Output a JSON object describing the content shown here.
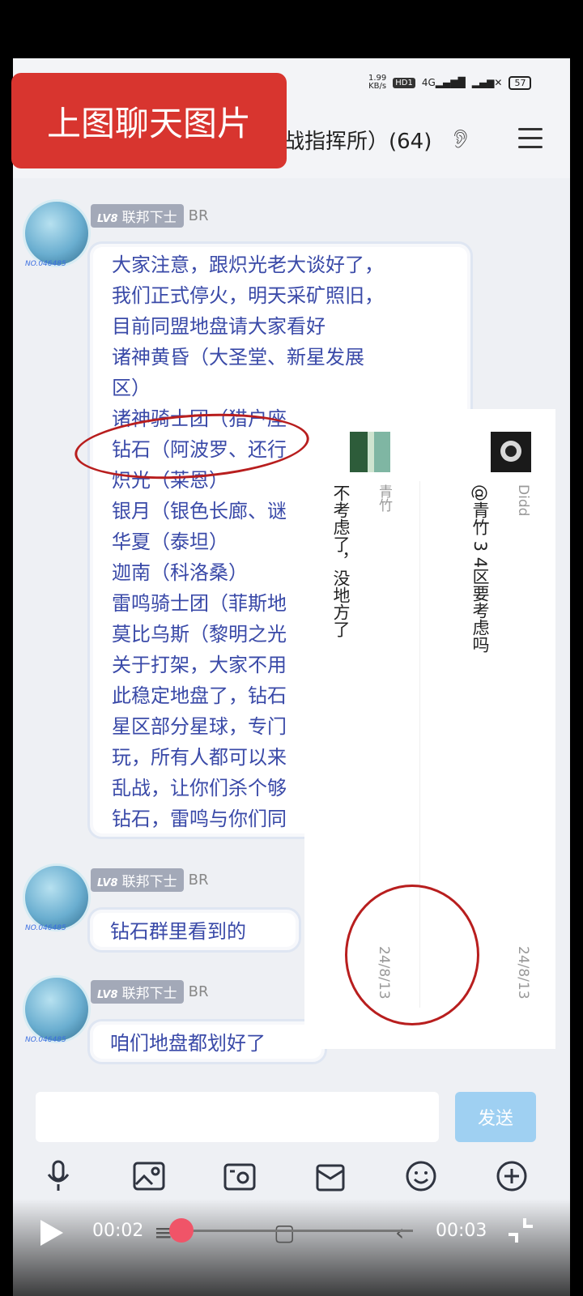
{
  "status_bar": {
    "net_speed": "1.99",
    "net_unit": "KB/s",
    "hd_badge": "HD1",
    "signal_4g": "4G",
    "battery": "57"
  },
  "header": {
    "banner": "上图聊天图片",
    "group_title": "战指挥所）(64)"
  },
  "messages": [
    {
      "level": "LV8",
      "rank": "联邦下士",
      "suffix": "BR",
      "avatar_tag": "NO.046485",
      "lines": [
        "大家注意，跟炽光老大谈好了，",
        "我们正式停火，明天采矿照旧，",
        "目前同盟地盘请大家看好",
        "诸神黄昏（大圣堂、新星发展",
        "区）",
        "诸神骑士团（猎户座",
        "钻石（阿波罗、还行",
        "炽光（莱恩）",
        "银月（银色长廊、谜",
        "华夏（泰坦）",
        "迦南（科洛桑）",
        "雷鸣骑士团（菲斯地",
        "莫比乌斯（黎明之光",
        "关于打架，大家不用",
        "此稳定地盘了，钻石",
        "星区部分星球，专门",
        "玩，所有人都可以来",
        "乱战，让你们杀个够",
        "钻石，雷鸣与你们同"
      ]
    },
    {
      "level": "LV8",
      "rank": "联邦下士",
      "suffix": "BR",
      "avatar_tag": "NO.046485",
      "text": "钻石群里看到的"
    },
    {
      "level": "LV8",
      "rank": "联邦下士",
      "suffix": "BR",
      "avatar_tag": "NO.046485",
      "text": "咱们地盘都划好了"
    }
  ],
  "overlay": {
    "left": {
      "name": "青竹",
      "text": "不考虑了，没地方了",
      "date": "24/8/13"
    },
    "right": {
      "name": "Didd",
      "text": "@青竹 3 4区要考虑吗",
      "date": "24/8/13"
    }
  },
  "input": {
    "send": "发送"
  },
  "player": {
    "current": "00:02",
    "total": "00:03",
    "progress": 0.02
  },
  "icons": [
    "mic-icon",
    "image-icon",
    "camera-icon",
    "gift-icon",
    "emoji-icon",
    "plus-icon"
  ],
  "colors": {
    "banner": "#d8352f",
    "message_text": "#3a4aa8",
    "annotation": "#b81e1e",
    "send_button": "#9fd0f2",
    "player_thumb": "#f05468"
  }
}
